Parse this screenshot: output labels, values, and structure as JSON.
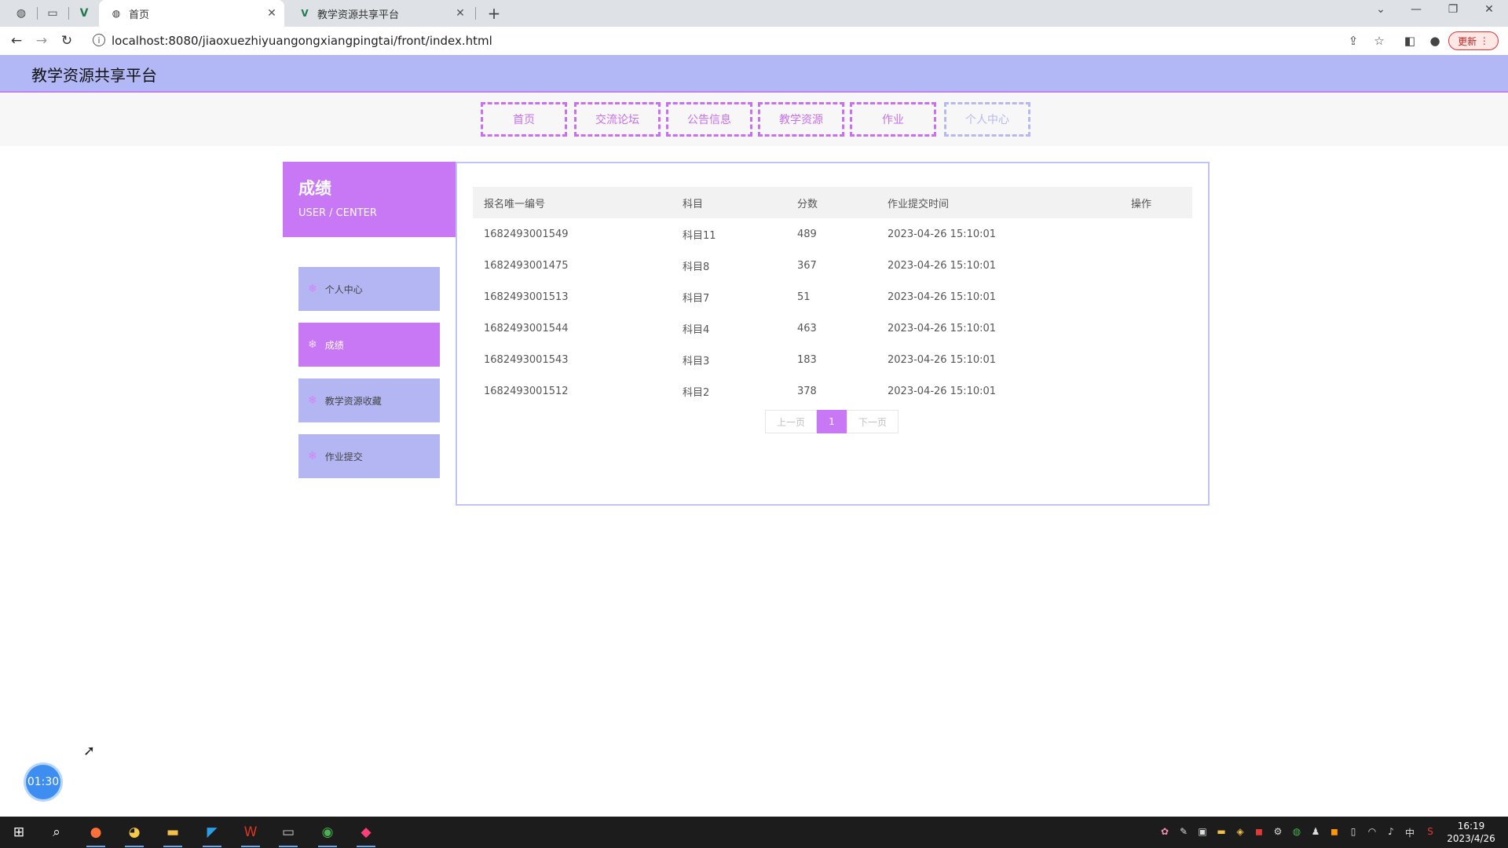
{
  "browser": {
    "tabs": [
      {
        "title": "首页",
        "active": true
      },
      {
        "title": "教学资源共享平台",
        "active": false
      }
    ],
    "url": "localhost:8080/jiaoxuezhiyuangongxiangpingtai/front/index.html",
    "update_label": "更新"
  },
  "site": {
    "title": "教学资源共享平台",
    "nav": [
      "首页",
      "交流论坛",
      "公告信息",
      "教学资源",
      "作业",
      "个人中心"
    ]
  },
  "sidebar": {
    "title": "成绩",
    "subtitle": "USER / CENTER",
    "items": [
      "个人中心",
      "成绩",
      "教学资源收藏",
      "作业提交"
    ],
    "active_index": 1
  },
  "table": {
    "columns": [
      "报名唯一编号",
      "科目",
      "分数",
      "作业提交时间",
      "操作"
    ],
    "rows": [
      [
        "1682493001549",
        "科目11",
        "489",
        "2023-04-26 15:10:01",
        ""
      ],
      [
        "1682493001475",
        "科目8",
        "367",
        "2023-04-26 15:10:01",
        ""
      ],
      [
        "1682493001513",
        "科目7",
        "51",
        "2023-04-26 15:10:01",
        ""
      ],
      [
        "1682493001544",
        "科目4",
        "463",
        "2023-04-26 15:10:01",
        ""
      ],
      [
        "1682493001543",
        "科目3",
        "183",
        "2023-04-26 15:10:01",
        ""
      ],
      [
        "1682493001512",
        "科目2",
        "378",
        "2023-04-26 15:10:01",
        ""
      ]
    ]
  },
  "pager": {
    "prev": "上一页",
    "current": "1",
    "next": "下一页"
  },
  "timer": "01:30",
  "taskbar": {
    "time": "16:19",
    "date": "2023/4/26",
    "ime": "中"
  },
  "colors": {
    "accent": "#c878f5",
    "header_bg": "#b1b8f5",
    "sidebar_item_bg": "#b3b6f2"
  }
}
